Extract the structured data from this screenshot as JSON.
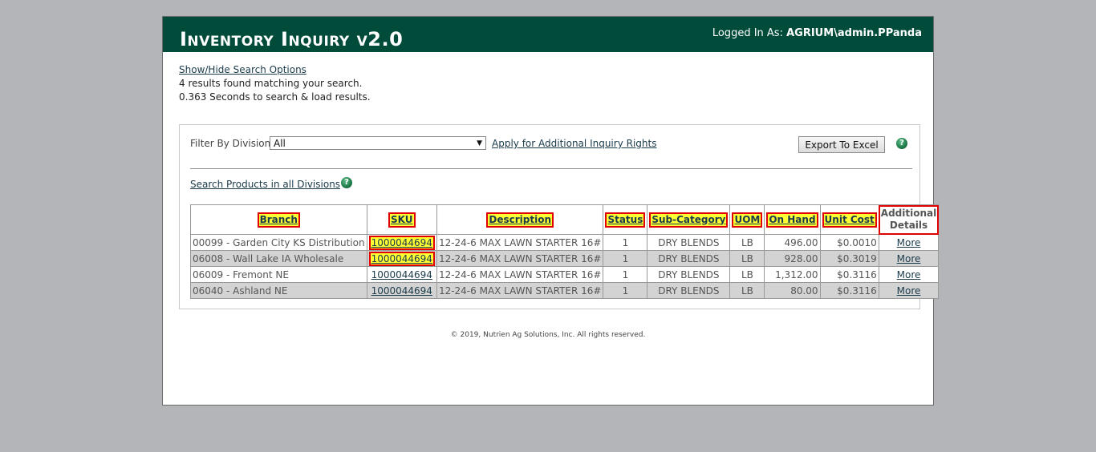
{
  "header": {
    "title": "Inventory Inquiry v2.0",
    "logged_in_label": "Logged In As:",
    "user": "AGRIUM\\admin.PPanda"
  },
  "summary": {
    "toggle_link": "Show/Hide Search Options",
    "results_text": "4 results found matching your search.",
    "timing_text": "0.363 Seconds to search & load results."
  },
  "filter": {
    "label": "Filter By Division:",
    "selected": "All",
    "apply_link": "Apply for Additional Inquiry Rights",
    "export_button": "Export To Excel",
    "help_glyph": "?"
  },
  "search_all_link": "Search Products in all Divisions",
  "table": {
    "headers": [
      "Branch",
      "SKU",
      "Description",
      "Status",
      "Sub-Category",
      "UOM",
      "On Hand",
      "Unit Cost"
    ],
    "additional_header_1": "Additional",
    "additional_header_2": "Details",
    "rows": [
      {
        "branch": "00099 - Garden City KS Distribution",
        "sku": "1000044694",
        "description": "12-24-6 MAX LAWN STARTER 16#",
        "status": "1",
        "subcategory": "DRY BLENDS",
        "uom": "LB",
        "on_hand": "496.00",
        "unit_cost": "$0.0010",
        "more": "More"
      },
      {
        "branch": "06008 - Wall Lake IA Wholesale",
        "sku": "1000044694",
        "description": "12-24-6 MAX LAWN STARTER 16#",
        "status": "1",
        "subcategory": "DRY BLENDS",
        "uom": "LB",
        "on_hand": "928.00",
        "unit_cost": "$0.3019",
        "more": "More"
      },
      {
        "branch": "06009 - Fremont NE",
        "sku": "1000044694",
        "description": "12-24-6 MAX LAWN STARTER 16#",
        "status": "1",
        "subcategory": "DRY BLENDS",
        "uom": "LB",
        "on_hand": "1,312.00",
        "unit_cost": "$0.3116",
        "more": "More"
      },
      {
        "branch": "06040 - Ashland NE",
        "sku": "1000044694",
        "description": "12-24-6 MAX LAWN STARTER 16#",
        "status": "1",
        "subcategory": "DRY BLENDS",
        "uom": "LB",
        "on_hand": "80.00",
        "unit_cost": "$0.3116",
        "more": "More"
      }
    ]
  },
  "footer": "© 2019, Nutrien Ag Solutions, Inc. All rights reserved.",
  "colors": {
    "header_bg": "#004b3a",
    "highlight": "#ffff33",
    "highlight_border": "#e00000",
    "page_bg": "#b4b5b9"
  }
}
